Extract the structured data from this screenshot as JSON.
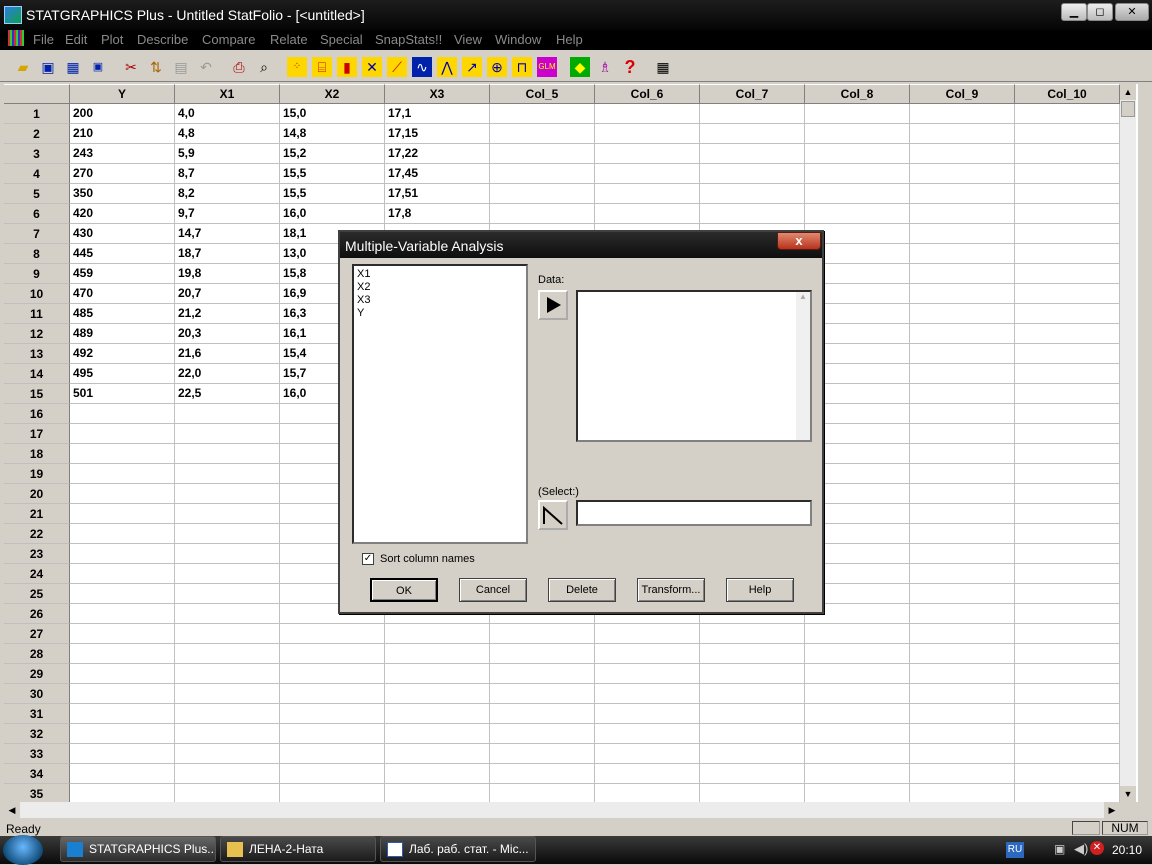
{
  "window": {
    "title": "STATGRAPHICS Plus - Untitled StatFolio - [<untitled>]"
  },
  "menu": [
    "File",
    "Edit",
    "Plot",
    "Describe",
    "Compare",
    "Relate",
    "Special",
    "SnapStats!!",
    "View",
    "Window",
    "Help"
  ],
  "toolbar_icons": [
    "open-folder-icon",
    "save-icon",
    "spreadsheet-icon",
    "save-data-icon",
    "cut-icon",
    "copy-icon",
    "paste-icon",
    "undo-icon",
    "print-icon",
    "print-preview-icon",
    "scatterplot-icon",
    "boxplot-icon",
    "histogram-icon",
    "control-chart-icon",
    "regression-icon",
    "time-series-icon",
    "distribution-icon",
    "multiplot-icon",
    "globe-icon",
    "tree-icon",
    "glm-icon",
    "snapstats-icon",
    "wizard-icon",
    "help-icon",
    "calculator-icon"
  ],
  "sheet": {
    "columns": [
      "Y",
      "X1",
      "X2",
      "X3",
      "Col_5",
      "Col_6",
      "Col_7",
      "Col_8",
      "Col_9",
      "Col_10"
    ],
    "row_numbers": [
      "1",
      "2",
      "3",
      "4",
      "5",
      "6",
      "7",
      "8",
      "9",
      "10",
      "11",
      "12",
      "13",
      "14",
      "15",
      "16",
      "17",
      "18",
      "19",
      "20",
      "21",
      "22",
      "23",
      "24",
      "25",
      "26",
      "27",
      "28",
      "29",
      "30",
      "31",
      "32",
      "33",
      "34",
      "35"
    ],
    "rows": [
      [
        "200",
        "4,0",
        "15,0",
        "17,1"
      ],
      [
        "210",
        "4,8",
        "14,8",
        "17,15"
      ],
      [
        "243",
        "5,9",
        "15,2",
        "17,22"
      ],
      [
        "270",
        "8,7",
        "15,5",
        "17,45"
      ],
      [
        "350",
        "8,2",
        "15,5",
        "17,51"
      ],
      [
        "420",
        "9,7",
        "16,0",
        "17,8"
      ],
      [
        "430",
        "14,7",
        "18,1",
        ""
      ],
      [
        "445",
        "18,7",
        "13,0",
        ""
      ],
      [
        "459",
        "19,8",
        "15,8",
        ""
      ],
      [
        "470",
        "20,7",
        "16,9",
        ""
      ],
      [
        "485",
        "21,2",
        "16,3",
        ""
      ],
      [
        "489",
        "20,3",
        "16,1",
        ""
      ],
      [
        "492",
        "21,6",
        "15,4",
        ""
      ],
      [
        "495",
        "22,0",
        "15,7",
        ""
      ],
      [
        "501",
        "22,5",
        "16,0",
        ""
      ]
    ]
  },
  "dialog": {
    "title": "Multiple-Variable Analysis",
    "close": "x",
    "variables": [
      "X1",
      "X2",
      "X3",
      "Y"
    ],
    "data_label": "Data:",
    "select_label": "(Select:)",
    "sort_label": "Sort column names",
    "sort_checked": true,
    "buttons": [
      "OK",
      "Cancel",
      "Delete",
      "Transform...",
      "Help"
    ]
  },
  "status": {
    "left": "Ready",
    "num": "NUM"
  },
  "taskbar": {
    "tasks": [
      "STATGRAPHICS Plus...",
      "ЛЕНА-2-Ната",
      "Лаб. раб. стат. - Mic..."
    ],
    "language": "RU",
    "clock": "20:10"
  },
  "colors": {
    "titlebar": "#0a0a0a",
    "face": "#d4d0c8",
    "close": "#c0442a"
  }
}
